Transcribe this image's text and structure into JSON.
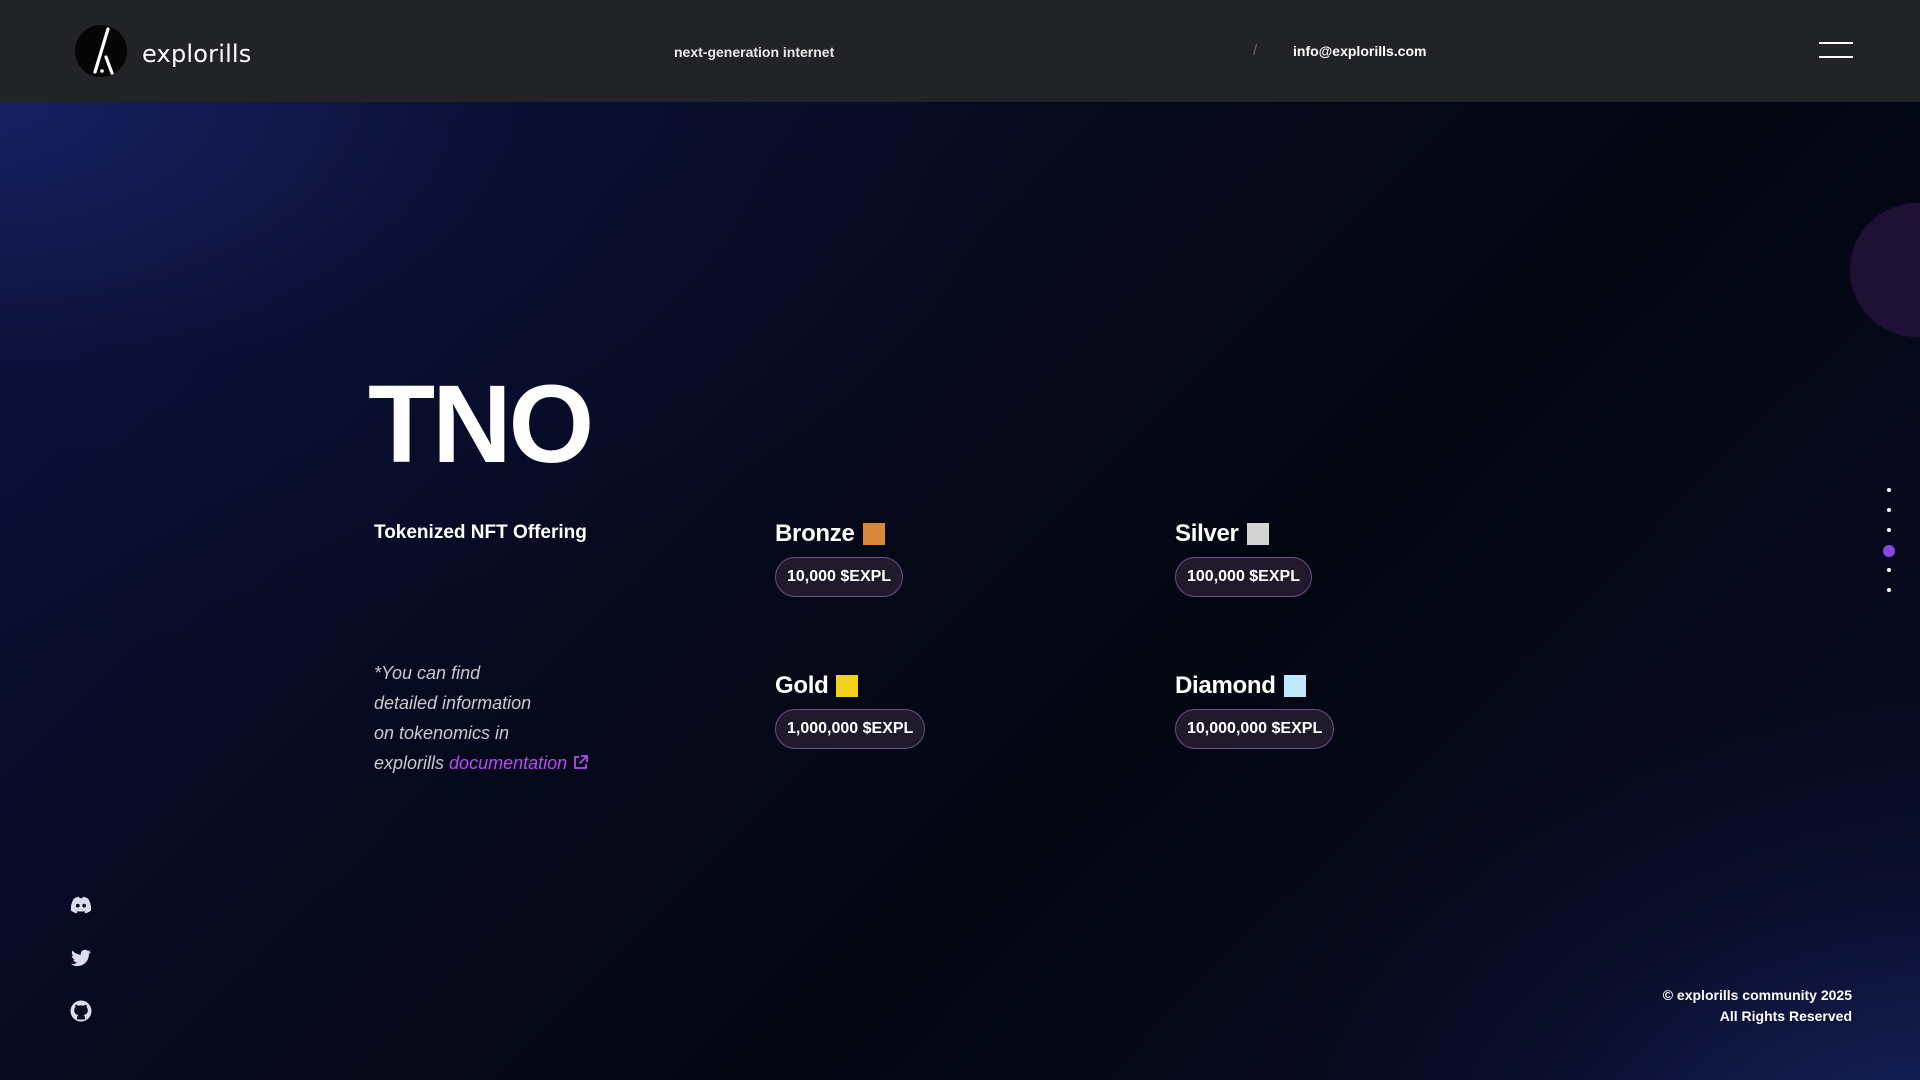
{
  "header": {
    "brand": "explorills",
    "tagline": "next-generation internet",
    "separator": "/",
    "email": "info@explorills.com",
    "logo_icon": "explorills-logo-icon",
    "menu_icon": "hamburger-menu-icon"
  },
  "hero": {
    "title": "TNO",
    "subtitle": "Tokenized NFT Offering"
  },
  "note": {
    "line1": "*You can find",
    "line2": "detailed information",
    "line3": "on tokenomics in",
    "line4_prefix": "explorills",
    "link_label": "documentation",
    "link_icon": "external-link-icon"
  },
  "tiers": [
    {
      "name": "Bronze",
      "color": "#d9873a",
      "price": "10,000 $EXPL"
    },
    {
      "name": "Silver",
      "color": "#d3d3d3",
      "price": "100,000 $EXPL"
    },
    {
      "name": "Gold",
      "color": "#f3d21c",
      "price": "1,000,000 $EXPL"
    },
    {
      "name": "Diamond",
      "color": "#bfe9fb",
      "price": "10,000,000 $EXPL"
    }
  ],
  "section_nav": {
    "count": 6,
    "active_index": 3
  },
  "socials": [
    "discord-icon",
    "twitter-icon",
    "github-icon"
  ],
  "footer": {
    "copyright": "© explorills community 2025",
    "rights": "All Rights Reserved"
  },
  "colors": {
    "accent": "#8b47e6",
    "link": "#b54cf0",
    "header_bg": "#222326"
  }
}
